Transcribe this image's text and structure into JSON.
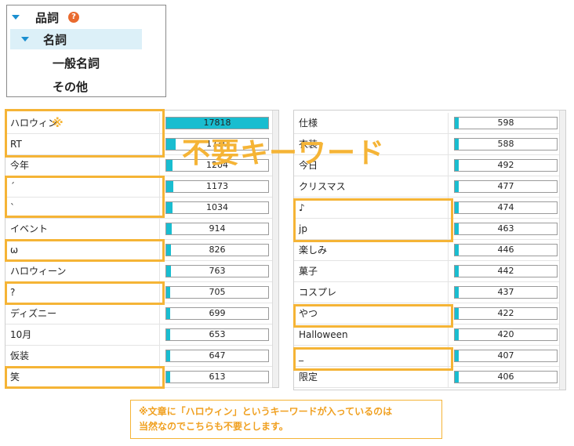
{
  "tree": {
    "root_label": "品詞",
    "help_glyph": "?",
    "child_label": "名詞",
    "leaf1": "一般名詞",
    "leaf2": "その他"
  },
  "left_table": {
    "rows": [
      {
        "keyword": "ハロウィン",
        "count": "17818",
        "value": 17818
      },
      {
        "keyword": "RT",
        "count": "1730",
        "value": 1730
      },
      {
        "keyword": "今年",
        "count": "1204",
        "value": 1204
      },
      {
        "keyword": "´",
        "count": "1173",
        "value": 1173
      },
      {
        "keyword": "`",
        "count": "1034",
        "value": 1034
      },
      {
        "keyword": "イベント",
        "count": "914",
        "value": 914
      },
      {
        "keyword": "ω",
        "count": "826",
        "value": 826
      },
      {
        "keyword": "ハロウィーン",
        "count": "763",
        "value": 763
      },
      {
        "keyword": "?",
        "count": "705",
        "value": 705
      },
      {
        "keyword": "ディズニー",
        "count": "699",
        "value": 699
      },
      {
        "keyword": "10月",
        "count": "653",
        "value": 653
      },
      {
        "keyword": "仮装",
        "count": "647",
        "value": 647
      },
      {
        "keyword": "笑",
        "count": "613",
        "value": 613
      }
    ]
  },
  "right_table": {
    "rows": [
      {
        "keyword": "仕様",
        "count": "598",
        "value": 598
      },
      {
        "keyword": "衣装",
        "count": "588",
        "value": 588
      },
      {
        "keyword": "今日",
        "count": "492",
        "value": 492
      },
      {
        "keyword": "クリスマス",
        "count": "477",
        "value": 477
      },
      {
        "keyword": "♪",
        "count": "474",
        "value": 474
      },
      {
        "keyword": "jp",
        "count": "463",
        "value": 463
      },
      {
        "keyword": "楽しみ",
        "count": "446",
        "value": 446
      },
      {
        "keyword": "菓子",
        "count": "442",
        "value": 442
      },
      {
        "keyword": "コスプレ",
        "count": "437",
        "value": 437
      },
      {
        "keyword": "やつ",
        "count": "422",
        "value": 422
      },
      {
        "keyword": "Halloween",
        "count": "420",
        "value": 420
      },
      {
        "keyword": "_",
        "count": "407",
        "value": 407
      },
      {
        "keyword": "限定",
        "count": "406",
        "value": 406
      }
    ]
  },
  "bar_max": 17818,
  "overlay": {
    "title": "不要キーワード",
    "kome_mark": "※"
  },
  "note": {
    "line1": "※文章に「ハロウィン」というキーワードが入っているのは",
    "line2": "当然なのでこちらも不要とします。"
  },
  "colors": {
    "accent": "#f5b436",
    "bar": "#19bdd0",
    "tree_select": "#dcf0f8"
  }
}
